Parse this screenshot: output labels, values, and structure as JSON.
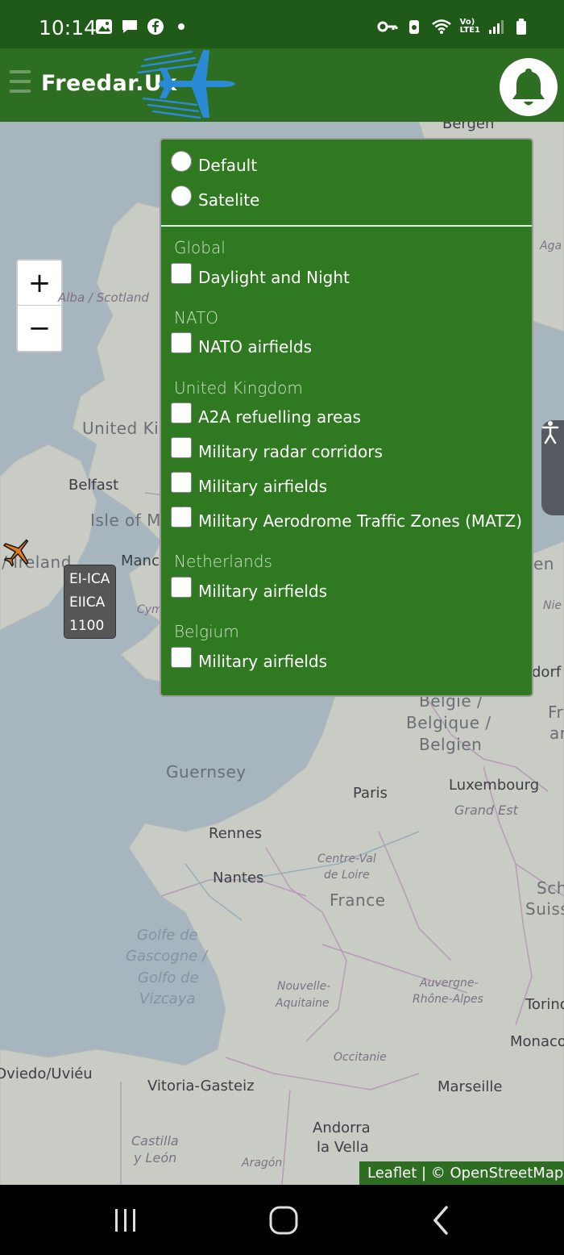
{
  "status_bar": {
    "time": "10:14",
    "lte_label_top": "Vo)",
    "lte_label_bottom": "LTE1",
    "left_icons": [
      "image-icon",
      "message-icon",
      "facebook-icon",
      "dot-icon"
    ],
    "right_icons": [
      "key-icon",
      "battery-saver-icon",
      "wifi-icon",
      "signal-icon",
      "battery-icon"
    ]
  },
  "header": {
    "brand": "Freedar.Uk",
    "menu_icon": "hamburger-icon",
    "notification_icon": "bell-icon"
  },
  "map": {
    "zoom_in": "+",
    "zoom_out": "−",
    "labels": {
      "bergen": "Bergen",
      "alba": "Alba / Scotland",
      "uk": "United Kingdom",
      "belfast": "Belfast",
      "isle_of_man": "Isle of Man",
      "ireland": "Éire / Ireland",
      "manchester": "Manchester",
      "cymru": "Cymru",
      "belgie": "België /",
      "belgique": "Belgique /",
      "belgien": "Belgien",
      "guernsey": "Guernsey",
      "paris": "Paris",
      "luxembourg": "Luxembourg",
      "grand_est": "Grand Est",
      "rennes": "Rennes",
      "nantes": "Nantes",
      "centre_val": "Centre-Val",
      "de_loire": "de Loire",
      "france": "France",
      "golfe": "Golfe de",
      "gascogne": "Gascogne /",
      "golfo": "Golfo de",
      "vizcaya": "Vizcaya",
      "auvergne": "Auvergne-",
      "rhone": "Rhône-Alpes",
      "nouvelle": "Nouvelle-",
      "aquitaine": "Aquitaine",
      "occitanie": "Occitanie",
      "oviedo": "Oviedo/Uviéu",
      "vitoria": "Vitoria-Gasteiz",
      "marseille": "Marseille",
      "andorra": "Andorra",
      "la_vella": "la Vella",
      "castilla": "Castilla",
      "y_leon": "y León",
      "aragon": "Aragón",
      "torino": "Torino",
      "monaco": "Monaco",
      "schweiz": "Schweiz",
      "suisse": "Suisse/",
      "dorf": "dorf",
      "fra": "Fra",
      "an": "an",
      "en": "en",
      "nie": "Nie",
      "aga": "Aga"
    },
    "aircraft": {
      "icon": "aircraft-icon",
      "line1": "EI-ICA",
      "line2": "EIICA",
      "line3": "1100"
    },
    "accessibility_icon": "accessibility-icon",
    "attribution": "Leaflet | © OpenStreetMap"
  },
  "layers": {
    "base": [
      {
        "label": "Default",
        "checked": false
      },
      {
        "label": "Satelite",
        "checked": false
      }
    ],
    "groups": [
      {
        "title": "Global",
        "items": [
          {
            "label": "Daylight and Night",
            "checked": false
          }
        ]
      },
      {
        "title": "NATO",
        "items": [
          {
            "label": "NATO airfields",
            "checked": false
          }
        ]
      },
      {
        "title": "United Kingdom",
        "items": [
          {
            "label": "A2A refuelling areas",
            "checked": false
          },
          {
            "label": "Military radar corridors",
            "checked": false
          },
          {
            "label": "Military airfields",
            "checked": false
          },
          {
            "label": "Military Aerodrome Traffic Zones (MATZ)",
            "checked": false
          }
        ]
      },
      {
        "title": "Netherlands",
        "items": [
          {
            "label": "Military airfields",
            "checked": false
          }
        ]
      },
      {
        "title": "Belgium",
        "items": [
          {
            "label": "Military airfields",
            "checked": false
          }
        ]
      }
    ]
  },
  "nav_bar": {
    "icons": [
      "recent-apps-icon",
      "home-icon",
      "back-icon"
    ]
  },
  "colors": {
    "header_green": "#2e6e22",
    "status_green": "#1f5a18",
    "panel_green": "#2f7a21",
    "map_sea": "#a6b5be",
    "map_land": "#c9cdc6"
  }
}
